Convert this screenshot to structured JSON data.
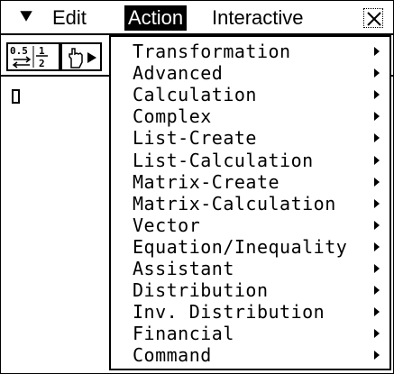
{
  "menubar": {
    "menu_icon": "chevron-down-icon",
    "edit": "Edit",
    "action": "Action",
    "interactive": "Interactive",
    "close_icon": "close-icon"
  },
  "toolbar": {
    "fraction_label": "0.5 1/2",
    "fraction_icon": "decimal-fraction-icon",
    "run_icon": "hand-run-icon"
  },
  "dropdown": {
    "items": [
      {
        "label": "Transformation"
      },
      {
        "label": "Advanced"
      },
      {
        "label": "Calculation"
      },
      {
        "label": "Complex"
      },
      {
        "label": "List-Create"
      },
      {
        "label": "List-Calculation"
      },
      {
        "label": "Matrix-Create"
      },
      {
        "label": "Matrix-Calculation"
      },
      {
        "label": "Vector"
      },
      {
        "label": "Equation/Inequality"
      },
      {
        "label": "Assistant"
      },
      {
        "label": "Distribution"
      },
      {
        "label": "Inv. Distribution"
      },
      {
        "label": "Financial"
      },
      {
        "label": "Command"
      }
    ]
  },
  "colors": {
    "foreground": "#000000",
    "background": "#ffffff",
    "highlight": "#000000"
  }
}
